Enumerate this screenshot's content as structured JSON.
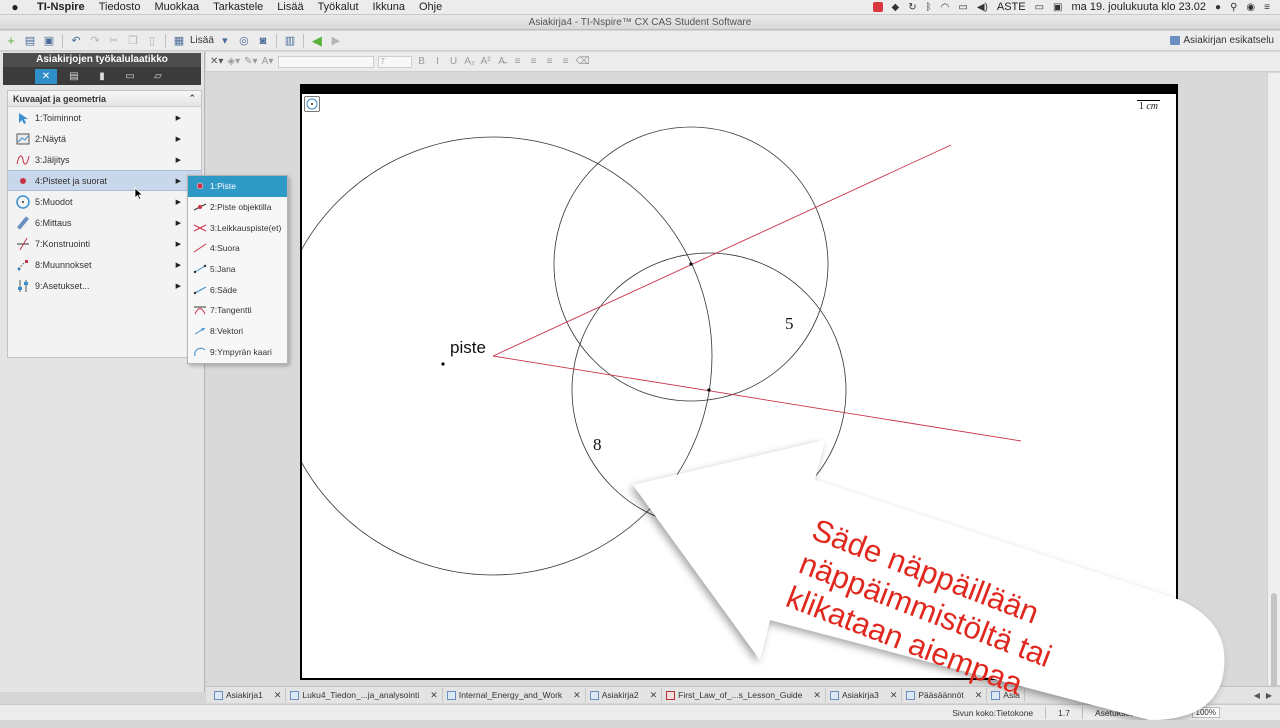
{
  "menubar": {
    "apple": "",
    "app_name": "TI-Nspire",
    "items": [
      "Tiedosto",
      "Muokkaa",
      "Tarkastele",
      "Lisää",
      "Työkalut",
      "Ikkuna",
      "Ohje"
    ],
    "input_source": "ASTE",
    "datetime": "ma 19. joulukuuta klo 23.02"
  },
  "window": {
    "title": "Asiakirja4 - TI-Nspire™ CX CAS Student Software"
  },
  "toolbar": {
    "insert_label": "Lisää",
    "preview_label": "Asiakirjan esikatselu"
  },
  "toolbox": {
    "title": "Asiakirjojen työkalulaatikko",
    "menu_title": "Kuvaajat ja geometria",
    "items": [
      {
        "label": "1:Toiminnot"
      },
      {
        "label": "2:Näytä"
      },
      {
        "label": "3:Jäljitys"
      },
      {
        "label": "4:Pisteet ja suorat"
      },
      {
        "label": "5:Muodot"
      },
      {
        "label": "6:Mittaus"
      },
      {
        "label": "7:Konstruointi"
      },
      {
        "label": "8:Muunnokset"
      },
      {
        "label": "9:Asetukset..."
      }
    ]
  },
  "submenu": {
    "items": [
      {
        "label": "1:Piste"
      },
      {
        "label": "2:Piste objektilla"
      },
      {
        "label": "3:Leikkauspiste(et)"
      },
      {
        "label": "4:Suora"
      },
      {
        "label": "5:Jana"
      },
      {
        "label": "6:Säde"
      },
      {
        "label": "7:Tangentti"
      },
      {
        "label": "8:Vektori"
      },
      {
        "label": "9:Ympyrän kaari"
      }
    ]
  },
  "format": {
    "font_size": "7"
  },
  "canvas": {
    "scale_value": "1",
    "scale_unit": "cm",
    "point_label": "piste",
    "radius_label_1": "5",
    "radius_label_2": "8"
  },
  "callout": {
    "lines": [
      "Säde näppäillään",
      "näppäimmistöltä tai",
      "klikataan aiempaa"
    ]
  },
  "tabs": [
    {
      "label": "Asiakirja1"
    },
    {
      "label": "Luku4_Tiedon_...ja_analysointi"
    },
    {
      "label": "Internal_Energy_and_Work"
    },
    {
      "label": "Asiakirja2"
    },
    {
      "label": "First_Law_of_...s_Lesson_Guide"
    },
    {
      "label": "Asiakirja3"
    },
    {
      "label": "Pääsäännöt"
    },
    {
      "label": "Asia"
    }
  ],
  "status": {
    "page_size": "Sivun koko:Tietokone",
    "version": "1.7",
    "settings": "Asetukset",
    "mode": "ASTE",
    "zoom": "100%"
  },
  "colors": {
    "accent": "#2f99c6",
    "line_red": "#c8324a",
    "callout_red": "#e0281f"
  }
}
